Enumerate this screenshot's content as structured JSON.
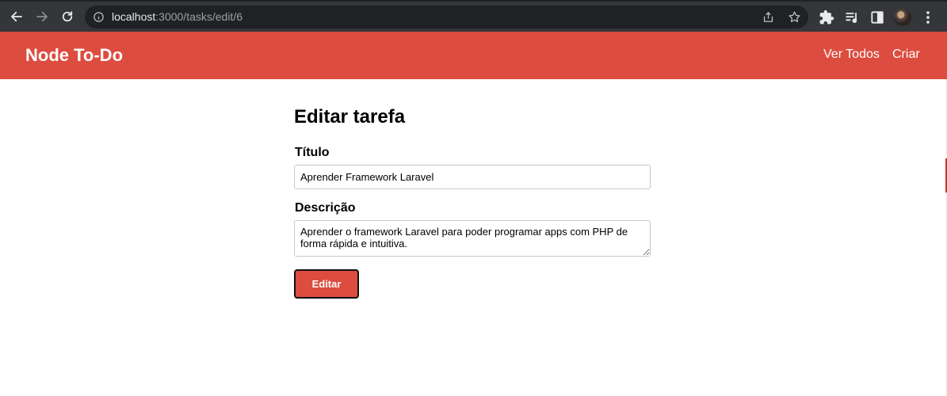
{
  "browser": {
    "url_host": "localhost",
    "url_path": ":3000/tasks/edit/6"
  },
  "navbar": {
    "brand": "Node To-Do",
    "links": [
      "Ver Todos",
      "Criar"
    ],
    "color": "#dc4c3f"
  },
  "form": {
    "title": "Editar tarefa",
    "title_label": "Título",
    "title_value": "Aprender Framework Laravel",
    "description_label": "Descrição",
    "description_value": "Aprender o framework Laravel para poder programar apps com PHP de forma rápida e intuitiva.",
    "submit_label": "Editar"
  },
  "icons": [
    "back-icon",
    "forward-icon",
    "reload-icon",
    "info-icon",
    "share-icon",
    "star-icon",
    "extensions-icon",
    "media-control-icon",
    "side-panel-icon",
    "profile-avatar",
    "menu-icon"
  ]
}
